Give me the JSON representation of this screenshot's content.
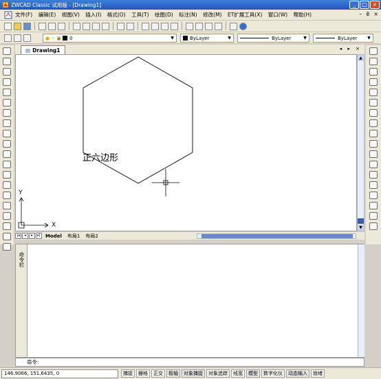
{
  "window": {
    "title": "ZWCAD Classic 试用版 - [Drawing1]",
    "controls": {
      "minimize": "_",
      "maximize": "□",
      "close": "×"
    }
  },
  "menubar": {
    "items": [
      "文件(F)",
      "编辑(E)",
      "视图(V)",
      "插入(I)",
      "格式(O)",
      "工具(T)",
      "绘图(D)",
      "标注(N)",
      "修改(M)",
      "ET扩展工具(X)",
      "窗口(W)",
      "帮助(H)"
    ],
    "mdi_controls": {
      "minimize": "–",
      "restore": "ē",
      "close": "×"
    }
  },
  "properties_bar": {
    "layer": "0",
    "color": "ByLayer",
    "linetype": "ByLayer",
    "lineweight": "ByLayer"
  },
  "document_tabs": [
    {
      "label": "Drawing1"
    }
  ],
  "canvas": {
    "annotation": "正六边形",
    "ucs_x_label": "X",
    "ucs_y_label": "Y"
  },
  "layout_tabs": [
    "Model",
    "布局1",
    "布局2"
  ],
  "command_panel": {
    "label": "命令栏",
    "prompt": "命令:"
  },
  "status_bar": {
    "coordinates": "146.9066,  151.6435,  0",
    "toggles": [
      {
        "label": "捕捉",
        "on": false
      },
      {
        "label": "栅格",
        "on": false
      },
      {
        "label": "正交",
        "on": false
      },
      {
        "label": "极轴",
        "on": true
      },
      {
        "label": "对象捕捉",
        "on": true
      },
      {
        "label": "对象追踪",
        "on": false
      },
      {
        "label": "线宽",
        "on": false
      },
      {
        "label": "模型",
        "on": true
      },
      {
        "label": "数字化仪",
        "on": false
      },
      {
        "label": "动态输入",
        "on": true
      },
      {
        "label": "就绪",
        "on": false
      }
    ]
  }
}
